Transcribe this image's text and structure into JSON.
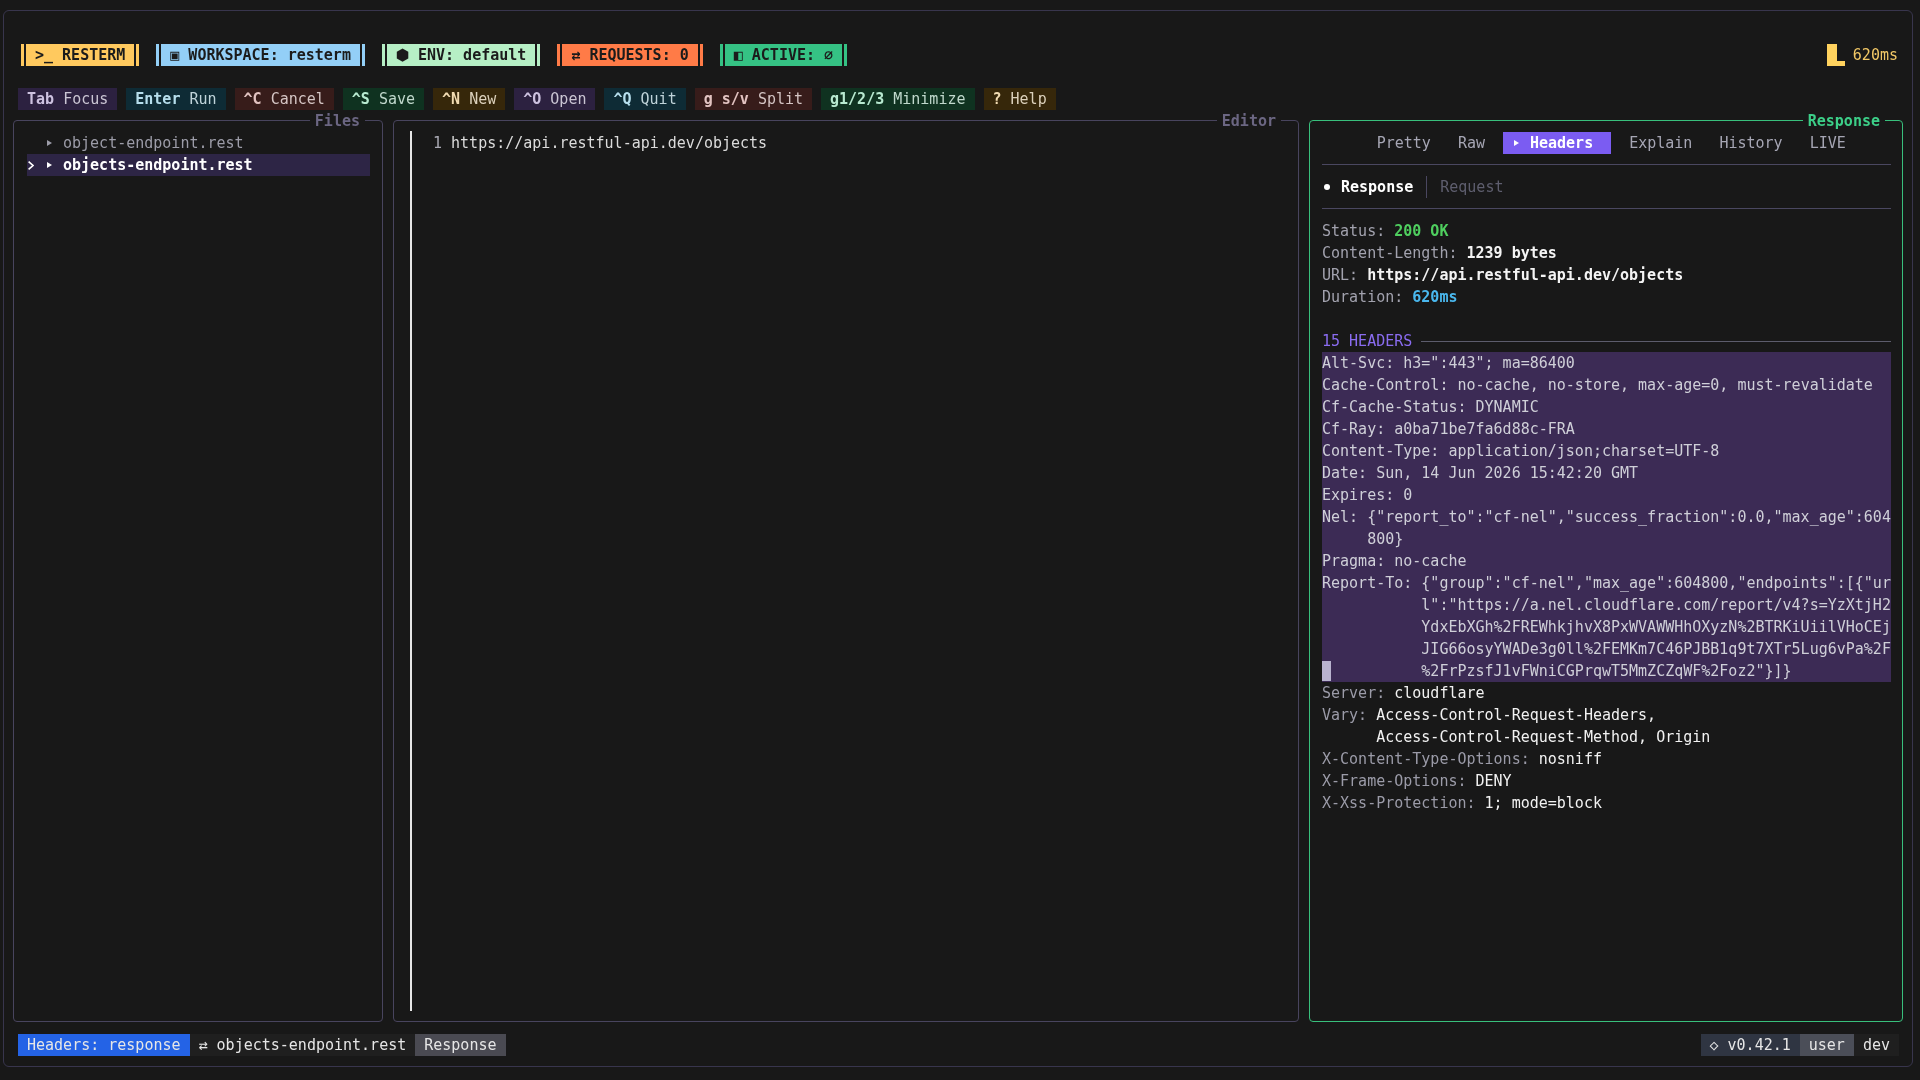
{
  "top_bar": {
    "badges": [
      {
        "text": ">_ RESTERM",
        "color": "#ffc95e"
      },
      {
        "text": "▣ WORKSPACE: resterm",
        "color": "#93cff7"
      },
      {
        "text": "⬢ ENV: default",
        "color": "#b6efc5"
      },
      {
        "text": "⇄ REQUESTS: 0",
        "color": "#ff7b47"
      },
      {
        "text": "◧ ACTIVE: ∅",
        "color": "#35c284"
      }
    ],
    "latency": "620ms"
  },
  "shortcuts": [
    {
      "key": "Tab",
      "label": "Focus",
      "color": "#2c2140"
    },
    {
      "key": "Enter",
      "label": "Run",
      "color": "#0e2b35"
    },
    {
      "key": "^C",
      "label": "Cancel",
      "color": "#371c1a"
    },
    {
      "key": "^S",
      "label": "Save",
      "color": "#0f3220"
    },
    {
      "key": "^N",
      "label": "New",
      "color": "#36270a"
    },
    {
      "key": "^O",
      "label": "Open",
      "color": "#2c2140"
    },
    {
      "key": "^Q",
      "label": "Quit",
      "color": "#0e2b35"
    },
    {
      "key": "g s/v",
      "label": "Split",
      "color": "#371c1a"
    },
    {
      "key": "g1/2/3",
      "label": "Minimize",
      "color": "#0f3220"
    },
    {
      "key": "?",
      "label": "Help",
      "color": "#36270a"
    }
  ],
  "files_panel": {
    "title": "Files",
    "focused": false,
    "items": [
      {
        "name": "object-endpoint.rest",
        "selected": false
      },
      {
        "name": "objects-endpoint.rest",
        "selected": true
      }
    ]
  },
  "editor_panel": {
    "title": "Editor",
    "focused": false,
    "lines": [
      {
        "number": "1",
        "text": "https://api.restful-api.dev/objects"
      }
    ]
  },
  "response_panel": {
    "title": "Response",
    "focused": true,
    "tabs": [
      {
        "label": "Pretty",
        "selected": false
      },
      {
        "label": "Raw",
        "selected": false
      },
      {
        "label": "Headers",
        "selected": true
      },
      {
        "label": "Explain",
        "selected": false
      },
      {
        "label": "History",
        "selected": false
      },
      {
        "label": "LIVE",
        "selected": false
      }
    ],
    "views": [
      {
        "label": "Response",
        "selected": true
      },
      {
        "label": "Request",
        "selected": false
      }
    ],
    "summary": [
      {
        "label": "Status:",
        "value": "200 OK",
        "color": "#4fcf5f"
      },
      {
        "label": "Content-Length:",
        "value": "1239 bytes",
        "color": "#f4f4f4"
      },
      {
        "label": "URL:",
        "value": "https://api.restful-api.dev/objects",
        "color": "#f4f4f4"
      },
      {
        "label": "Duration:",
        "value": "620ms",
        "color": "#4ab8ee"
      }
    ],
    "headers_title": "15 HEADERS",
    "headers": [
      {
        "name": "Alt-Svc:",
        "value": "h3=\":443\"; ma=86400",
        "selected": true
      },
      {
        "name": "Cache-Control:",
        "value": "no-cache, no-store, max-age=0, must-revalidate",
        "selected": true
      },
      {
        "name": "Cf-Cache-Status:",
        "value": "DYNAMIC",
        "selected": true
      },
      {
        "name": "Cf-Ray:",
        "value": "a0ba71be7fa6d88c-FRA",
        "selected": true
      },
      {
        "name": "Content-Type:",
        "value": "application/json;charset=UTF-8",
        "selected": true
      },
      {
        "name": "Date:",
        "value": "Sun, 14 Jun 2026 15:42:20 GMT",
        "selected": true
      },
      {
        "name": "Expires:",
        "value": "0",
        "selected": true
      },
      {
        "name": "Nel:",
        "value": "{\"report_to\":\"cf-nel\",\"success_fraction\":0.0,\"max_age\":604800}",
        "selected": true
      },
      {
        "name": "Pragma:",
        "value": "no-cache",
        "selected": true
      },
      {
        "name": "Report-To:",
        "value": "{\"group\":\"cf-nel\",\"max_age\":604800,\"endpoints\":[{\"url\":\"https://a.nel.cloudflare.com/report/v4?s=YzXtjH2YdxEbXGh%2FREWhkjhvX8PxWVAWWHhOXyzN%2BTRKiUiilVHoCEjJIG66osyYWADe3g0ll%2FEMKm7C46PJBB1q9t7XTr5Lug6vPa%2F%2FrPzsfJ1vFWniCGPrqwT5MmZCZqWF%2Foz2\"}]}",
        "selected": true
      },
      {
        "name": "Server:",
        "value": "cloudflare",
        "selected": false
      },
      {
        "name": "Vary:",
        "value": "Access-Control-Request-Headers, Access-Control-Request-Method, Origin",
        "selected": false
      },
      {
        "name": "X-Content-Type-Options:",
        "value": "nosniff",
        "selected": false
      },
      {
        "name": "X-Frame-Options:",
        "value": "DENY",
        "selected": false
      },
      {
        "name": "X-Xss-Protection:",
        "value": "1; mode=block",
        "selected": false
      }
    ]
  },
  "status_bar": {
    "left": [
      {
        "text": "Headers: response",
        "color": "#2463e6"
      },
      {
        "text": "⇄ objects-endpoint.rest",
        "color": "#1f1f1f"
      },
      {
        "text": "Response",
        "color": "#4a4a52"
      }
    ],
    "right": [
      {
        "text": "◇ v0.42.1",
        "color": "#2f3542"
      },
      {
        "text": "user",
        "color": "#4b4e58"
      },
      {
        "text": "dev",
        "color": "#1f1f1f"
      }
    ]
  }
}
